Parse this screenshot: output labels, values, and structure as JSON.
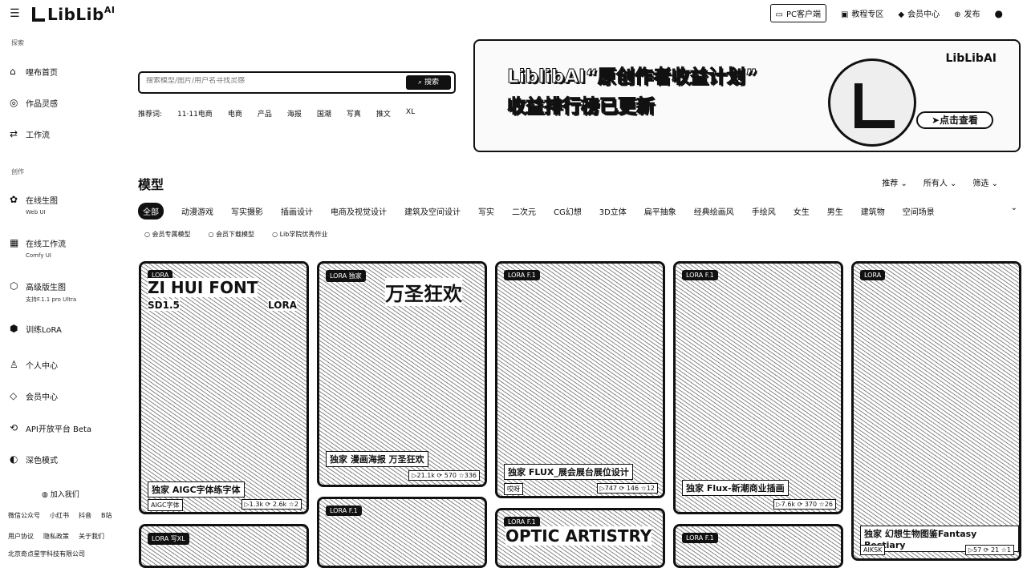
{
  "topbar": {
    "logo": "LibLib",
    "logo_ai": "AI",
    "pc_client": "PC客户端",
    "tutorials": "教程专区",
    "membership": "会员中心",
    "publish": "发布"
  },
  "sidebar": {
    "section_explore": "探索",
    "items": [
      {
        "label": "哩布首页"
      },
      {
        "label": "作品灵感"
      },
      {
        "label": "工作流"
      }
    ],
    "section_create": "创作",
    "create_items": [
      {
        "label": "在线生图",
        "sub": "Web UI"
      },
      {
        "label": "在线工作流",
        "sub": "Comfy UI"
      },
      {
        "label": "高级版生图",
        "sub": "支持F.1.1 pro Ultra"
      },
      {
        "label": "训练LoRA"
      }
    ],
    "other_items": [
      {
        "label": "个人中心"
      },
      {
        "label": "会员中心"
      },
      {
        "label": "API开放平台 Beta"
      },
      {
        "label": "深色模式"
      }
    ],
    "join": "加入我们",
    "footer1": [
      "微信公众号",
      "小红书",
      "抖音",
      "B站"
    ],
    "footer2": [
      "用户协议",
      "隐私政策",
      "关于我们"
    ],
    "company": "北京奇点星宇科技有限公司"
  },
  "search": {
    "placeholder": "搜索模型/图片/用户名寻找灵感",
    "button": "搜索",
    "rec_label": "推荐词:",
    "rec_words": [
      "11·11电商",
      "电商",
      "产品",
      "海报",
      "国潮",
      "写真",
      "推文",
      "XL"
    ]
  },
  "banner": {
    "line1": "LiblibAI“原创作者收益计划”",
    "line2": "收益排行榜已更新",
    "logo": "LibLibAI",
    "cta": "点击查看"
  },
  "models": {
    "title": "模型",
    "sorts": [
      "推荐",
      "所有人",
      "筛选"
    ],
    "categories": [
      "全部",
      "动漫游戏",
      "写实摄影",
      "插画设计",
      "电商及视觉设计",
      "建筑及空间设计",
      "写实",
      "二次元",
      "CG幻想",
      "3D立体",
      "扁平抽象",
      "经典绘画风",
      "手绘风",
      "女生",
      "男生",
      "建筑物",
      "空间场景"
    ],
    "filters": [
      "会员专属模型",
      "会员下载模型",
      "Lib学院优秀作业"
    ]
  },
  "cards": [
    {
      "badge": "LORA",
      "big1": "ZI HUI FONT",
      "big2": "SD1.5",
      "big3": "LORA",
      "title": "独家 AIGC字体练字体",
      "author": "AIGC字体",
      "stats": "▷1.3k ⟳ 2.6k ☆2"
    },
    {
      "badge": "LORA 独家",
      "big1": "万圣狂欢",
      "title": "独家 漫画海报 万圣狂欢",
      "author": "",
      "stats": "▷21.1k ⟳ 570 ☆336"
    },
    {
      "badge": "LORA F.1",
      "title": "独家 FLUX_展会展台展位设计",
      "author": "哎呀",
      "stats": "▷747 ⟳ 146 ☆12"
    },
    {
      "badge": "LORA F.1",
      "title": "独家 Flux-新潮商业插画",
      "author": "",
      "stats": "▷7.6k ⟳ 370 ☆26"
    },
    {
      "badge": "LORA",
      "title": "独家 幻想生物图鉴Fantasy Bestiary",
      "author": "AIKSK",
      "stats": "▷57 ⟳ 21 ☆1"
    },
    {
      "badge": "LORA 写XL"
    },
    {
      "badge": "LORA F.1"
    },
    {
      "badge": "LORA F.1",
      "big1": "OPTIC ARTISTRY"
    },
    {
      "badge": "LORA F.1"
    }
  ]
}
